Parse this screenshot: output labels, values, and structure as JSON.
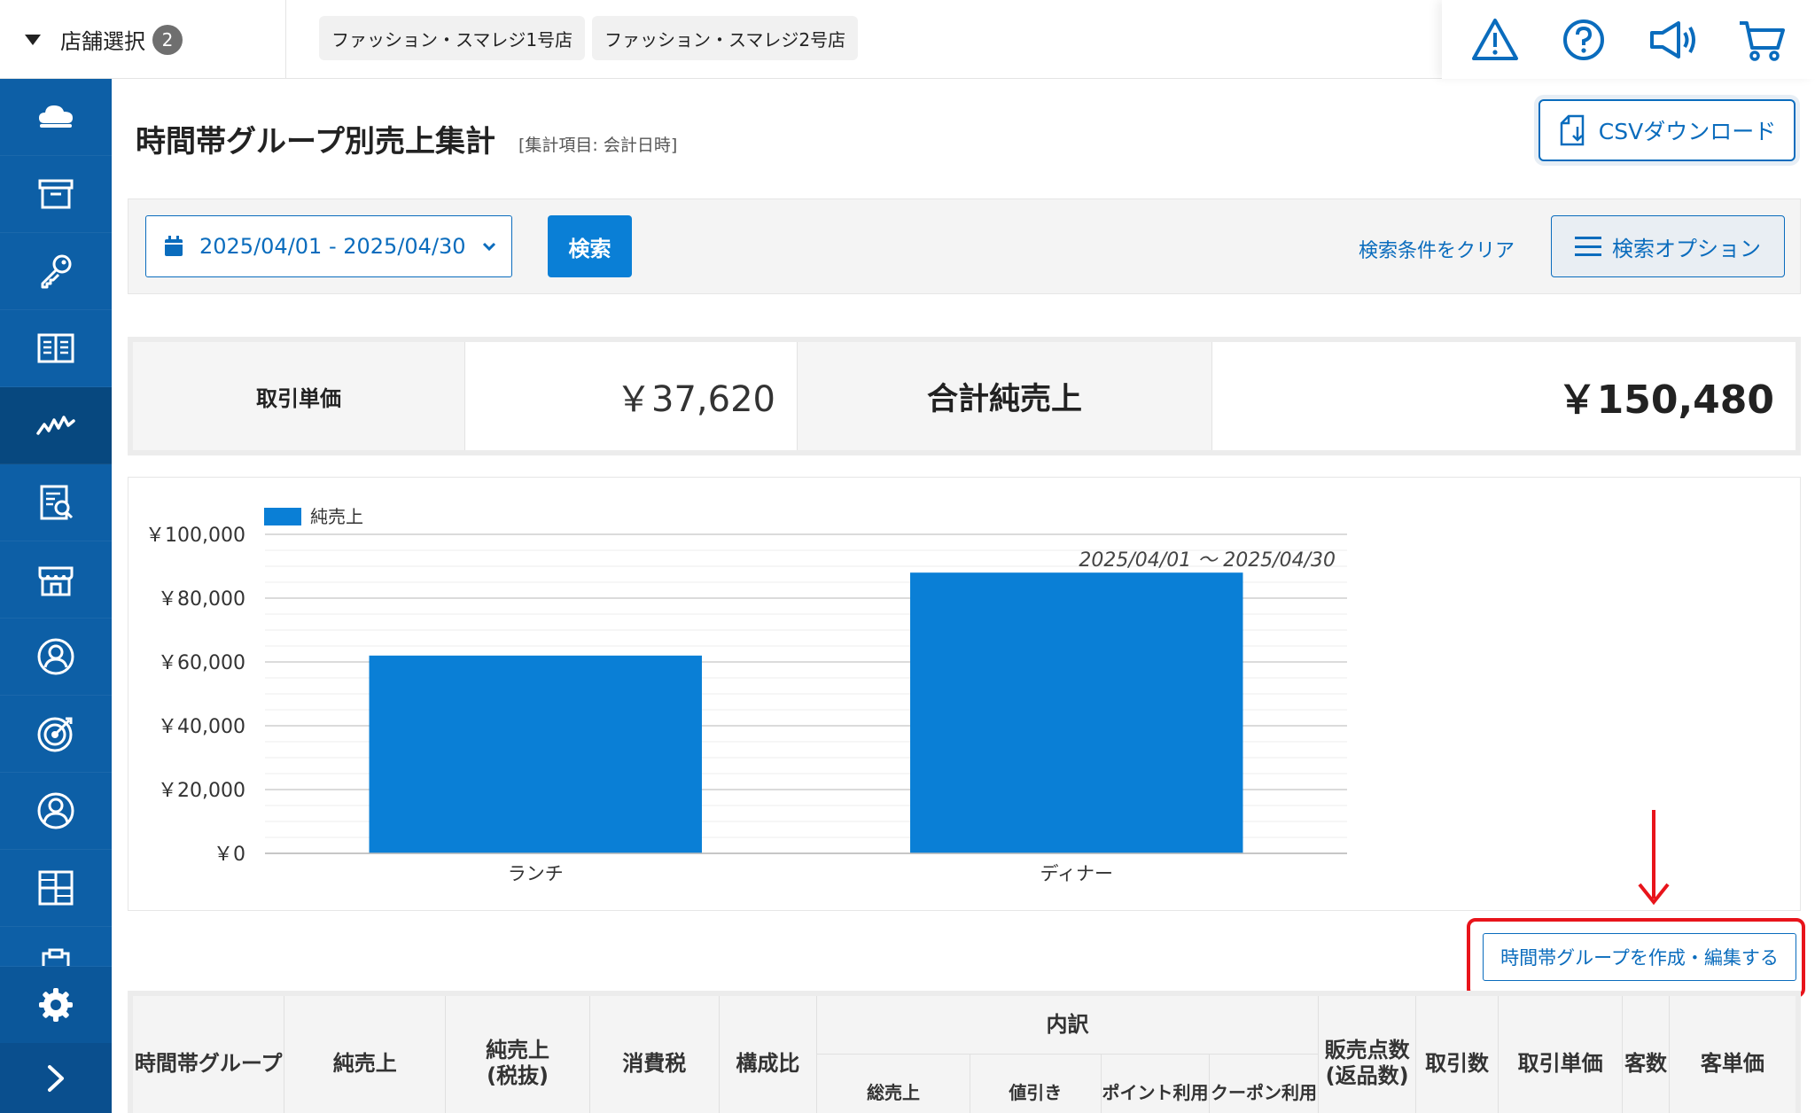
{
  "topbar": {
    "store_select_label": "店舗選択",
    "store_count": "2",
    "stores": [
      "ファッション・スマレジ1号店",
      "ファッション・スマレジ2号店"
    ],
    "icons": [
      "warning-icon",
      "help-icon",
      "megaphone-icon",
      "cart-icon"
    ]
  },
  "sidebar": {
    "items": [
      "cloud-icon",
      "archive-icon",
      "key-icon",
      "book-icon",
      "sales-chart-icon",
      "report-icon",
      "store-icon",
      "customer-icon",
      "target-icon",
      "user-icon",
      "grid-icon",
      "clipboard-icon"
    ],
    "active": "sales-chart-icon",
    "bottom": [
      "settings-icon",
      "expand-icon"
    ]
  },
  "page": {
    "title": "時間帯グループ別売上集計",
    "subtitle": "[集計項目: 会計日時]",
    "csv_button": "CSVダウンロード"
  },
  "search": {
    "date_range": "2025/04/01 - 2025/04/30",
    "search_button": "検索",
    "clear_link": "検索条件をクリア",
    "options_button": "検索オプション"
  },
  "summary": {
    "unit_price_label": "取引単価",
    "unit_price_value": "￥37,620",
    "total_label": "合計純売上",
    "total_value": "￥150,480"
  },
  "chart_data": {
    "type": "bar",
    "categories": [
      "ランチ",
      "ディナー"
    ],
    "series": [
      {
        "name": "純売上",
        "values": [
          62000,
          88000
        ],
        "color": "#0a7fd6"
      }
    ],
    "ylim": [
      0,
      100000
    ],
    "yticks": [
      "￥0",
      "￥20,000",
      "￥40,000",
      "￥60,000",
      "￥80,000",
      "￥100,000"
    ],
    "annotation": "2025/04/01 ～ 2025/04/30",
    "legend": "top-left",
    "grid": true
  },
  "edit_button": "時間帯グループを作成・編集する",
  "table": {
    "headers": {
      "group": "時間帯グループ",
      "net_sales": "純売上",
      "net_sales_ex": "純売上\n(税抜)",
      "tax": "消費税",
      "ratio": "構成比",
      "breakdown": "内訳",
      "gross": "総売上",
      "discount": "値引き",
      "points": "ポイント利用",
      "coupon": "クーポン利用",
      "items_sold": "販売点数\n(返品数)",
      "transactions": "取引数",
      "unit_price": "取引単価",
      "customers": "客数",
      "customer_price": "客単価"
    }
  },
  "colors": {
    "sidebar": "#0d5fa6",
    "accent": "#0a6cbd",
    "bar": "#0a7fd6",
    "highlight": "#e8141b"
  }
}
